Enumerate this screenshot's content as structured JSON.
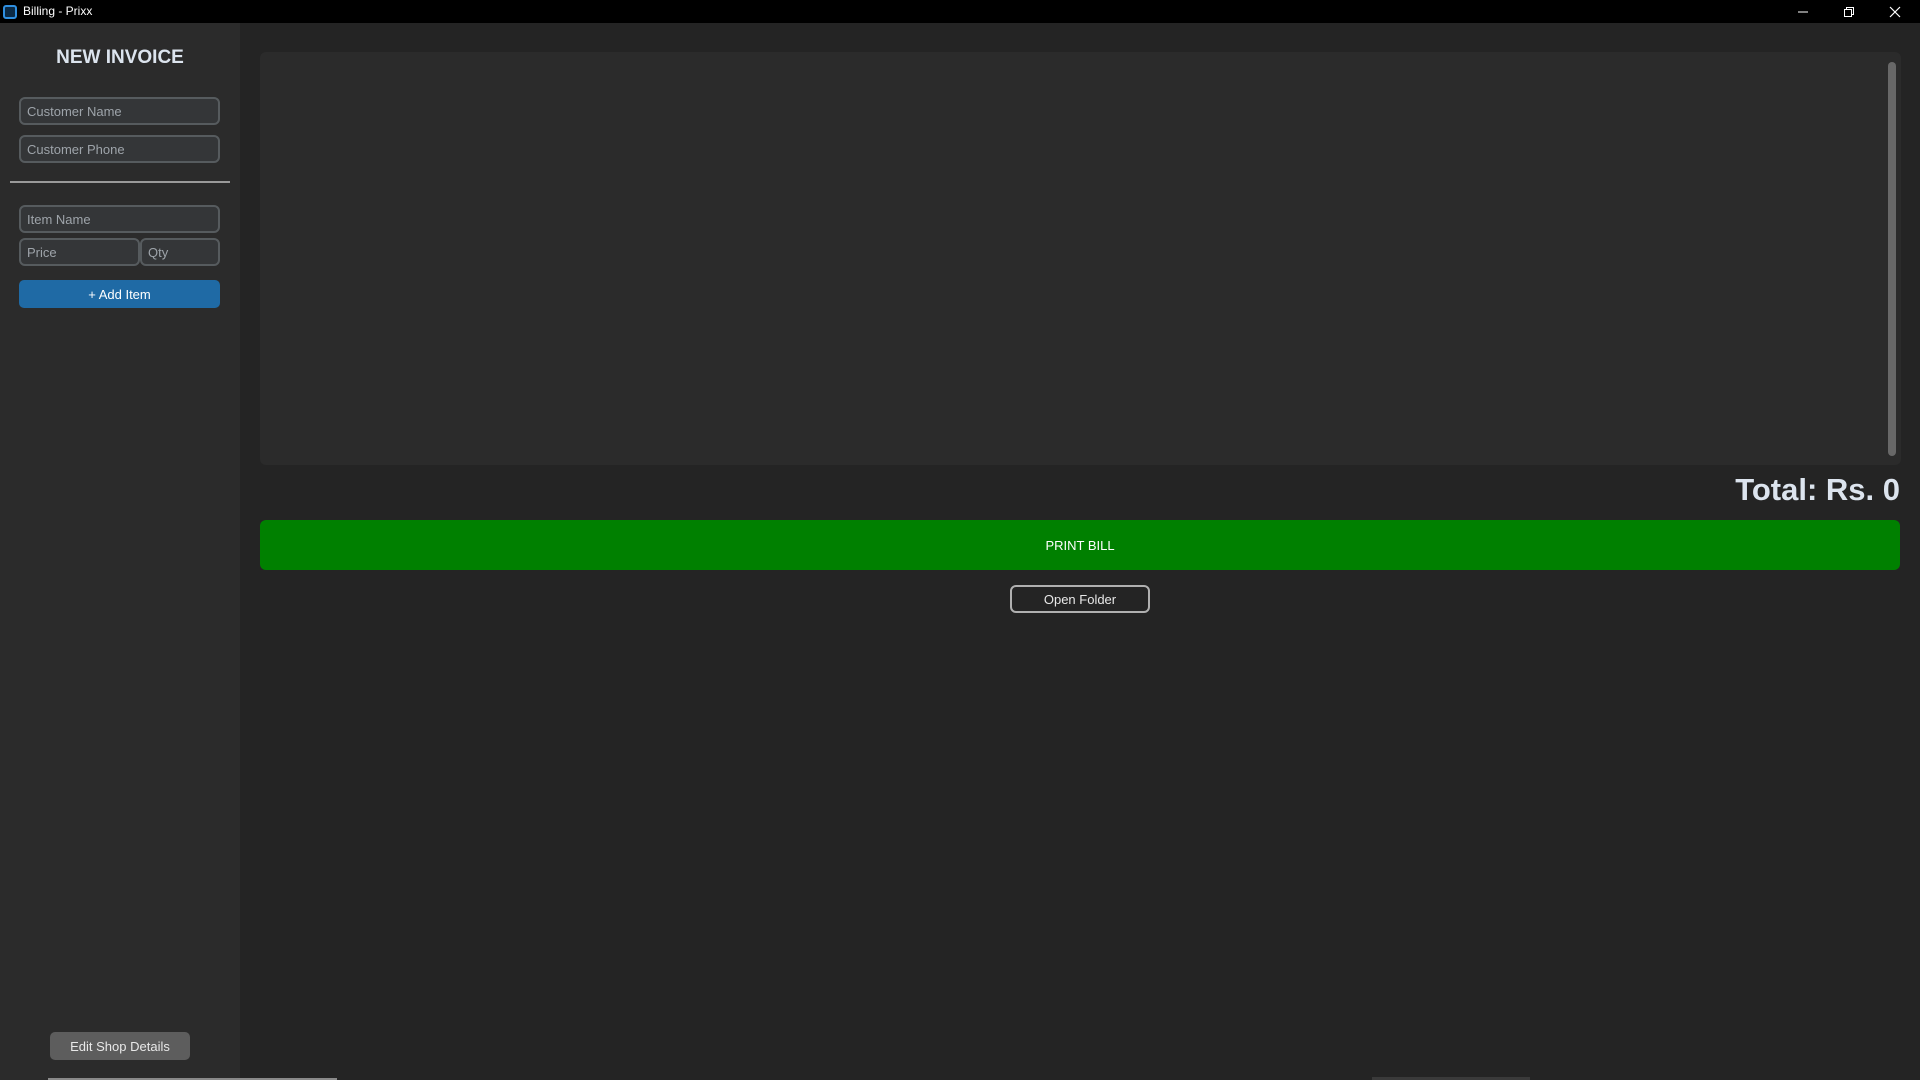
{
  "window": {
    "title": "Billing - Prixx"
  },
  "sidebar": {
    "title": "NEW INVOICE",
    "customer_name_placeholder": "Customer Name",
    "customer_phone_placeholder": "Customer Phone",
    "item_name_placeholder": "Item Name",
    "price_placeholder": "Price",
    "qty_placeholder": "Qty",
    "add_item_label": "+ Add Item",
    "edit_shop_label": "Edit Shop Details"
  },
  "main": {
    "items": [],
    "total_label": "Total: Rs. 0",
    "print_label": "PRINT BILL",
    "open_folder_label": "Open Folder"
  },
  "colors": {
    "accent_blue": "#1f6aa5",
    "print_green": "#008000",
    "background": "#242424",
    "panel": "#2b2b2b"
  },
  "icons": {
    "app": "app-icon",
    "minimize": "minimize-icon",
    "restore": "restore-icon",
    "close": "close-icon"
  }
}
